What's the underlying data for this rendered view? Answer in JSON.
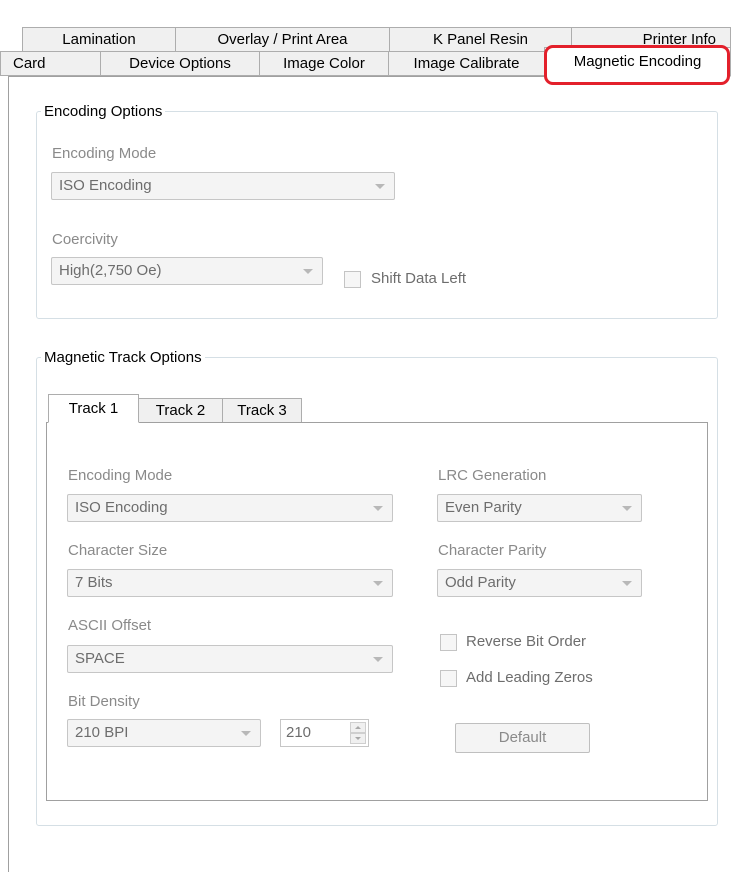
{
  "tabs_row_back": [
    {
      "label": "Lamination"
    },
    {
      "label": "Overlay / Print Area"
    },
    {
      "label": "K Panel Resin"
    },
    {
      "label": "Printer Info"
    }
  ],
  "tabs_row_front": [
    {
      "label": "Card"
    },
    {
      "label": "Device Options"
    },
    {
      "label": "Image Color"
    },
    {
      "label": "Image Calibrate"
    },
    {
      "label": "Magnetic Encoding",
      "active": true
    }
  ],
  "encoding_options": {
    "title": "Encoding Options",
    "encoding_mode_label": "Encoding Mode",
    "encoding_mode_value": "ISO Encoding",
    "coercivity_label": "Coercivity",
    "coercivity_value": "High(2,750 Oe)",
    "shift_data_left_label": "Shift Data Left",
    "shift_data_left_checked": false
  },
  "track_options": {
    "title": "Magnetic Track Options",
    "tabs": [
      {
        "label": "Track 1",
        "active": true
      },
      {
        "label": "Track 2"
      },
      {
        "label": "Track 3"
      }
    ],
    "encoding_mode_label": "Encoding Mode",
    "encoding_mode_value": "ISO Encoding",
    "character_size_label": "Character Size",
    "character_size_value": "7 Bits",
    "ascii_offset_label": "ASCII Offset",
    "ascii_offset_value": "SPACE",
    "bit_density_label": "Bit Density",
    "bit_density_value": "210 BPI",
    "bit_density_number": "210",
    "lrc_generation_label": "LRC Generation",
    "lrc_generation_value": "Even Parity",
    "character_parity_label": "Character Parity",
    "character_parity_value": "Odd Parity",
    "reverse_bit_order_label": "Reverse Bit Order",
    "add_leading_zeros_label": "Add Leading Zeros",
    "default_button_label": "Default"
  },
  "colors": {
    "highlight": "#e3202b",
    "disabled_text": "#8a8a8a"
  }
}
